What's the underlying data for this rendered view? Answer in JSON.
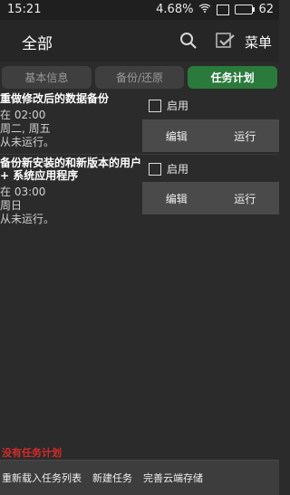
{
  "status_bar": {
    "time": "15:21",
    "speed": "4.68",
    "speed_unit": "%",
    "battery": "62"
  },
  "top_bar": {
    "title": "全部",
    "menu_label": "菜单"
  },
  "tabs": [
    {
      "label": "基本信息",
      "active": false
    },
    {
      "label": "备份/还原",
      "active": false
    },
    {
      "label": "任务计划",
      "active": true
    }
  ],
  "tasks": [
    {
      "title": "重做修改后的数据备份",
      "time": "在 02:00",
      "days": "周二, 周五",
      "status": "从未运行。",
      "enable_label": "启用",
      "edit_label": "编辑",
      "run_label": "运行"
    },
    {
      "title": "备份新安装的和新版本的用户 + 系统应用程序",
      "time": "在 03:00",
      "days": "周日",
      "status": "从未运行。",
      "enable_label": "启用",
      "edit_label": "编辑",
      "run_label": "运行"
    }
  ],
  "empty_message": "没有任务计划",
  "bottom_bar": {
    "reload_label": "重新载入任务列表",
    "new_label": "新建任务",
    "cloud_label": "完善云端存储"
  },
  "colors": {
    "accent": "#2a7a3c",
    "warning": "#d52a2a"
  }
}
